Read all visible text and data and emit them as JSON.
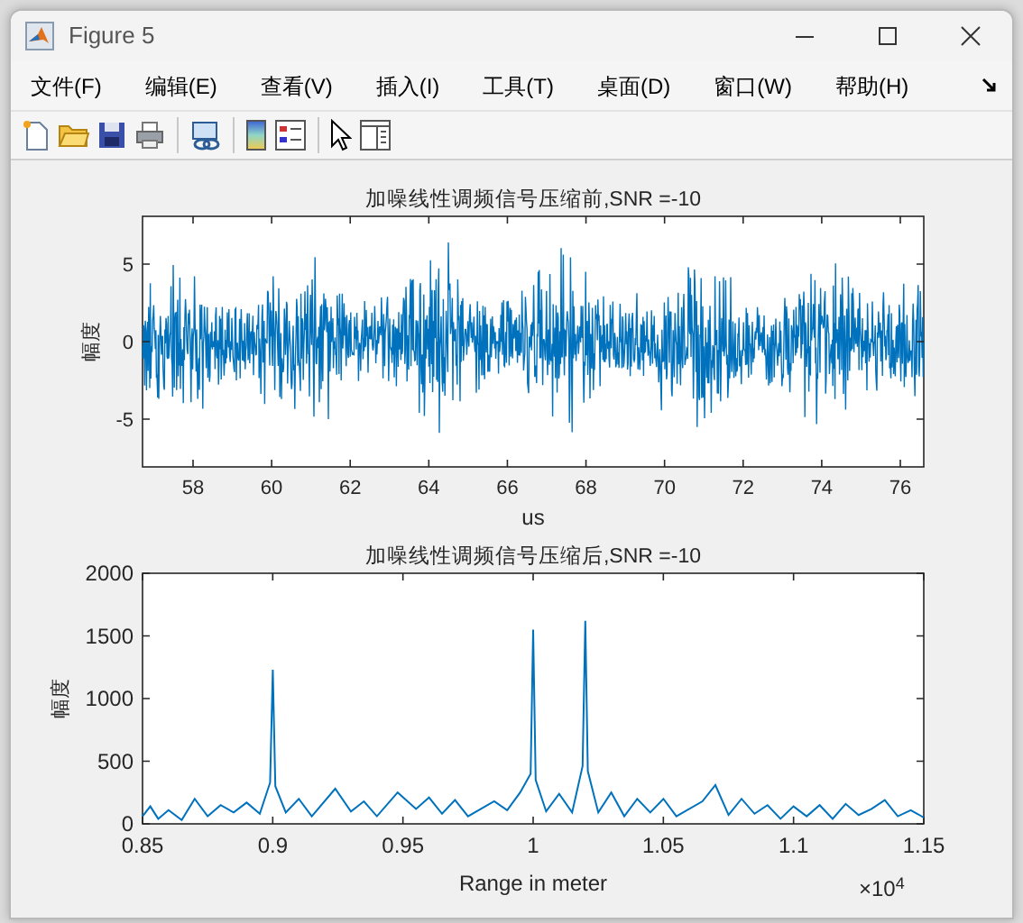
{
  "window": {
    "title": "Figure 5"
  },
  "menu": [
    {
      "label": "文件(F)"
    },
    {
      "label": "编辑(E)"
    },
    {
      "label": "查看(V)"
    },
    {
      "label": "插入(I)"
    },
    {
      "label": "工具(T)"
    },
    {
      "label": "桌面(D)"
    },
    {
      "label": "窗口(W)"
    },
    {
      "label": "帮助(H)"
    }
  ],
  "waveform_plot": {
    "title": "加噪线性调频信号压缩前,SNR =-10",
    "ylabel": "幅度",
    "xlabel": "us",
    "xticks": [
      "58",
      "60",
      "62",
      "64",
      "66",
      "68",
      "70",
      "72",
      "74",
      "76"
    ],
    "yticks": [
      "5",
      "0",
      "-5"
    ]
  },
  "range_plot": {
    "chart_data": {
      "type": "line",
      "title": "加噪线性调频信号压缩后,SNR =-10",
      "xlabel": "Range in meter",
      "ylabel": "幅度",
      "xlim": [
        0.85,
        1.15
      ],
      "ylim": [
        0,
        2000
      ],
      "xticks": [
        0.85,
        0.9,
        0.95,
        1,
        1.05,
        1.1,
        1.15
      ],
      "yticks": [
        0,
        500,
        1000,
        1500,
        2000
      ],
      "x": [
        0.85,
        0.853,
        0.856,
        0.86,
        0.865,
        0.87,
        0.875,
        0.88,
        0.885,
        0.89,
        0.895,
        0.899,
        0.9,
        0.901,
        0.905,
        0.91,
        0.915,
        0.924,
        0.93,
        0.935,
        0.94,
        0.948,
        0.955,
        0.96,
        0.965,
        0.97,
        0.975,
        0.985,
        0.99,
        0.995,
        0.999,
        1,
        1.001,
        1.005,
        1.01,
        1.015,
        1.019,
        1.02,
        1.021,
        1.025,
        1.03,
        1.035,
        1.04,
        1.045,
        1.05,
        1.055,
        1.065,
        1.07,
        1.075,
        1.08,
        1.085,
        1.09,
        1.095,
        1.1,
        1.105,
        1.11,
        1.115,
        1.12,
        1.125,
        1.13,
        1.135,
        1.14,
        1.145,
        1.15
      ],
      "series": [
        {
          "color": "#0072bd",
          "values": [
            60,
            140,
            40,
            110,
            30,
            200,
            60,
            150,
            90,
            170,
            80,
            330,
            1230,
            300,
            90,
            200,
            60,
            280,
            100,
            180,
            60,
            250,
            120,
            210,
            80,
            190,
            60,
            180,
            110,
            250,
            400,
            1550,
            350,
            100,
            240,
            90,
            460,
            1620,
            420,
            90,
            250,
            60,
            200,
            90,
            200,
            60,
            180,
            310,
            70,
            200,
            80,
            150,
            40,
            140,
            60,
            150,
            40,
            160,
            70,
            120,
            190,
            60,
            110,
            50
          ]
        }
      ],
      "annotations": [
        {
          "text": "×10$^{4}$"
        }
      ]
    }
  }
}
